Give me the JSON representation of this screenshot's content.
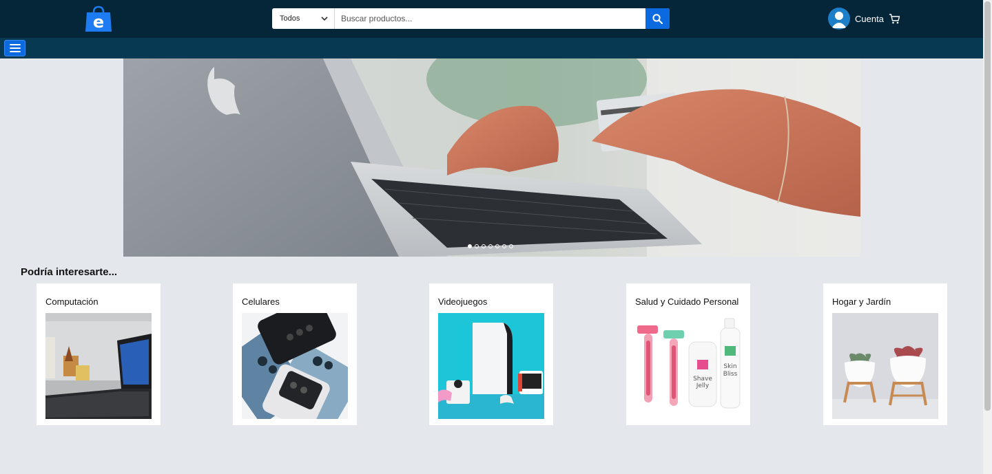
{
  "header": {
    "logo_letter": "e",
    "search": {
      "category": "Todos",
      "placeholder": "Buscar productos..."
    },
    "account_label": "Cuenta"
  },
  "hero": {
    "slide_count": 7,
    "active_slide": 0
  },
  "section": {
    "title": "Podría interesarte..."
  },
  "categories": [
    {
      "label": "Computación"
    },
    {
      "label": "Celulares"
    },
    {
      "label": "Videojuegos"
    },
    {
      "label": "Salud y Cuidado Personal"
    },
    {
      "label": "Hogar y Jardín"
    }
  ],
  "colors": {
    "header_bg": "#052538",
    "nav_bg": "#073a52",
    "accent": "#0c6ae0",
    "page_bg": "#e4e7ec"
  }
}
